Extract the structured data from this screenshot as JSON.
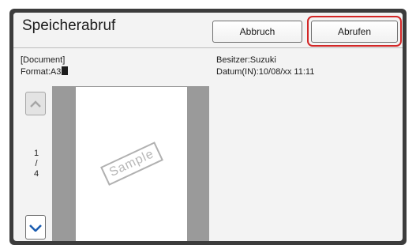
{
  "header": {
    "title": "Speicherabruf",
    "cancel_label": "Abbruch",
    "recall_label": "Abrufen"
  },
  "document": {
    "name": "[Document]",
    "format": "Format:A3",
    "owner": "Besitzer:Suzuki",
    "date": "Datum(IN):10/08/xx 11:11"
  },
  "pagination": {
    "current": "1",
    "separator": "/",
    "total": "4"
  },
  "preview": {
    "watermark": "Sample"
  },
  "colors": {
    "highlight": "#d32626",
    "nav_arrow": "#1c5db0",
    "nav_arrow_disabled": "#a6a6a6"
  }
}
